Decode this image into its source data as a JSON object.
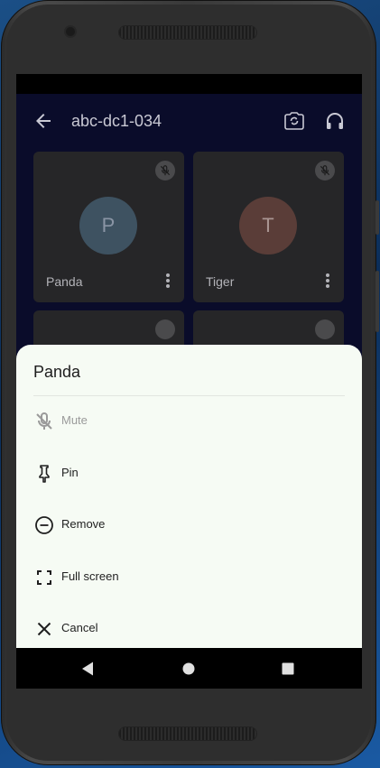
{
  "appbar": {
    "title": "abc-dc1-034",
    "icons": [
      "arrow-back-icon",
      "switch-camera-icon",
      "headphones-icon"
    ]
  },
  "participants": [
    {
      "name": "Panda",
      "initial": "P",
      "avatar_color": "#3e5261",
      "muted": true
    },
    {
      "name": "Tiger",
      "initial": "T",
      "avatar_color": "#5a3d38",
      "muted": true
    }
  ],
  "sheet": {
    "title": "Panda",
    "items": [
      {
        "label": "Mute",
        "icon": "mic-off-icon",
        "enabled": false
      },
      {
        "label": "Pin",
        "icon": "pin-icon",
        "enabled": true
      },
      {
        "label": "Remove",
        "icon": "remove-circle-icon",
        "enabled": true
      },
      {
        "label": "Full screen",
        "icon": "fullscreen-icon",
        "enabled": true
      },
      {
        "label": "Cancel",
        "icon": "close-icon",
        "enabled": true
      }
    ]
  },
  "navbar": {
    "icons": [
      "back-triangle-icon",
      "home-circle-icon",
      "recents-square-icon"
    ]
  },
  "colors": {
    "app_background": "#0a0c2a",
    "sheet_background": "#f6fbf4",
    "tile_background": "#262628"
  }
}
